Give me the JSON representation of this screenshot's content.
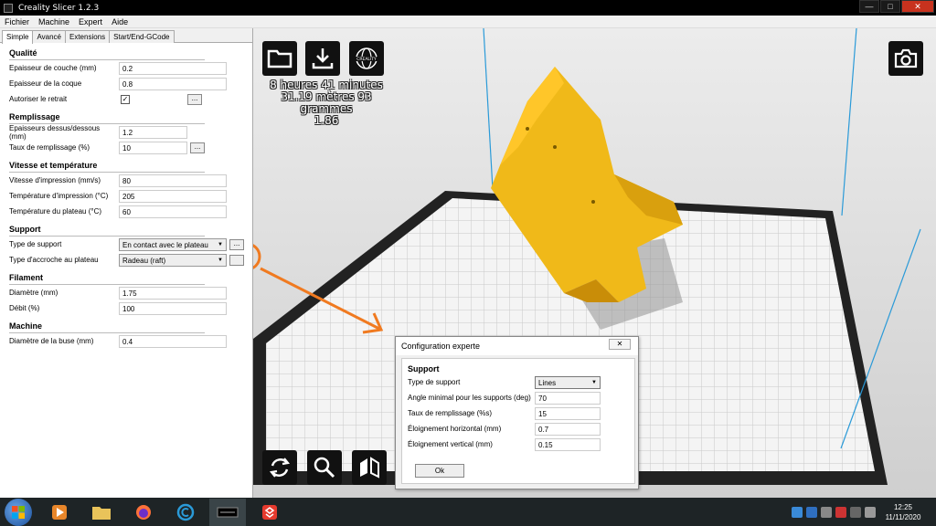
{
  "window": {
    "title": "Creality Slicer 1.2.3",
    "minimize": "—",
    "maximize": "□",
    "close": "✕"
  },
  "menu": [
    "Fichier",
    "Machine",
    "Expert",
    "Aide"
  ],
  "tabs": [
    "Simple",
    "Avancé",
    "Extensions",
    "Start/End-GCode"
  ],
  "sections": {
    "qualite": {
      "title": "Qualité",
      "layer_height_label": "Epaisseur de couche (mm)",
      "layer_height": "0.2",
      "shell_label": "Epaisseur de la coque",
      "shell": "0.8",
      "retract_label": "Autoriser le retrait",
      "retract_checked": "✓"
    },
    "remplissage": {
      "title": "Remplissage",
      "topbottom_label": "Epaisseurs dessus/dessous (mm)",
      "topbottom": "1.2",
      "density_label": "Taux de remplissage (%)",
      "density": "10"
    },
    "vitesse": {
      "title": "Vitesse et température",
      "speed_label": "Vitesse d'impression (mm/s)",
      "speed": "80",
      "temp_label": "Température d'impression (°C)",
      "temp": "205",
      "bed_label": "Température du plateau (°C)",
      "bed": "60"
    },
    "support": {
      "title": "Support",
      "type_label": "Type de support",
      "type": "En contact avec le plateau",
      "adhesion_label": "Type d'accroche au plateau",
      "adhesion": "Radeau (raft)"
    },
    "filament": {
      "title": "Filament",
      "diameter_label": "Diamètre (mm)",
      "diameter": "1.75",
      "flow_label": "Débit (%)",
      "flow": "100"
    },
    "machine": {
      "title": "Machine",
      "nozzle_label": "Diamètre de la buse (mm)",
      "nozzle": "0.4"
    }
  },
  "dots_label": "...",
  "dropdown_arrow": "▼",
  "stats": {
    "time": "8 heures 41 minutes",
    "material": "31.19 mètres 93 grammes",
    "cost": "1.86"
  },
  "dialog": {
    "title": "Configuration experte",
    "close": "✕",
    "section": "Support",
    "rows": [
      {
        "label": "Type de support",
        "value": "Lines"
      },
      {
        "label": "Angle minimal pour les supports (deg)",
        "value": "70"
      },
      {
        "label": "Taux de remplissage (%s)",
        "value": "15"
      },
      {
        "label": "Éloignement horizontal (mm)",
        "value": "0.7"
      },
      {
        "label": "Éloignement vertical (mm)",
        "value": "0.15"
      }
    ],
    "ok": "Ok"
  },
  "taskbar": {
    "time": "12:25",
    "date": "11/11/2020"
  },
  "colors": {
    "model": "#f0b919",
    "viewport": "#d8d8d8",
    "highlight": "#f07a20",
    "frame": "#2a9ad8"
  }
}
